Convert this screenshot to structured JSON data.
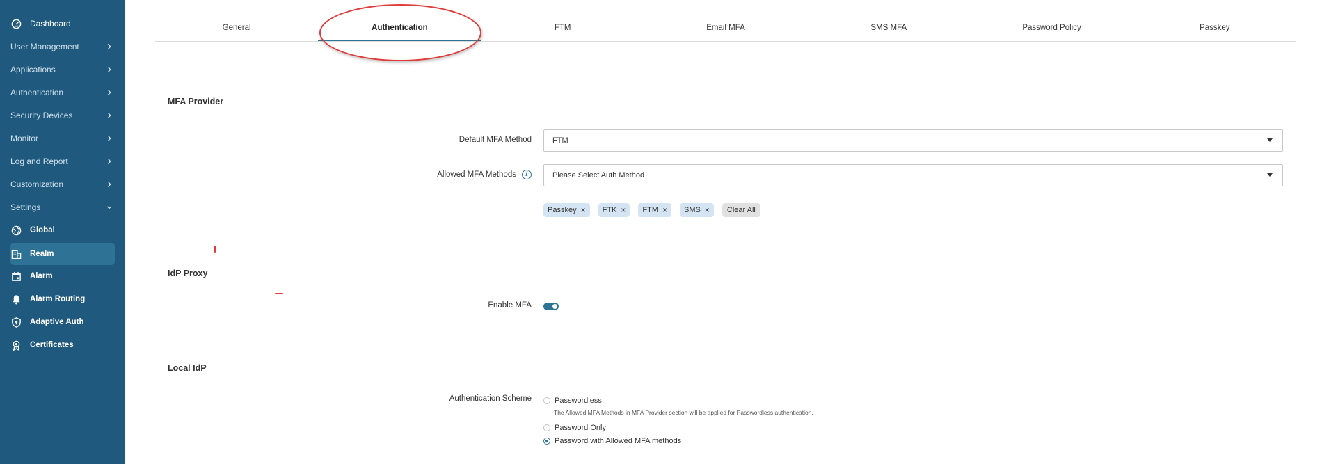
{
  "sidebar": {
    "items": [
      {
        "label": "Dashboard",
        "icon": "dashboard-icon"
      },
      {
        "label": "User Management",
        "chevron": "right"
      },
      {
        "label": "Applications",
        "chevron": "right"
      },
      {
        "label": "Authentication",
        "chevron": "right"
      },
      {
        "label": "Security Devices",
        "chevron": "right"
      },
      {
        "label": "Monitor",
        "chevron": "right"
      },
      {
        "label": "Log and Report",
        "chevron": "right"
      },
      {
        "label": "Customization",
        "chevron": "right"
      },
      {
        "label": "Settings",
        "chevron": "down"
      }
    ],
    "settings_children": [
      {
        "label": "Global",
        "icon": "globe-icon"
      },
      {
        "label": "Realm",
        "icon": "building-icon",
        "active": true
      },
      {
        "label": "Alarm",
        "icon": "calendar-icon"
      },
      {
        "label": "Alarm Routing",
        "icon": "bell-icon"
      },
      {
        "label": "Adaptive Auth",
        "icon": "shield-icon"
      },
      {
        "label": "Certificates",
        "icon": "certificate-icon"
      }
    ]
  },
  "tabs": [
    {
      "label": "General"
    },
    {
      "label": "Authentication",
      "active": true
    },
    {
      "label": "FTM"
    },
    {
      "label": "Email MFA"
    },
    {
      "label": "SMS MFA"
    },
    {
      "label": "Password Policy"
    },
    {
      "label": "Passkey"
    }
  ],
  "mfa_provider": {
    "title": "MFA Provider",
    "default_label": "Default MFA Method",
    "default_value": "FTM",
    "allowed_label": "Allowed MFA Methods",
    "allowed_placeholder": "Please Select Auth Method",
    "chips": [
      "Passkey",
      "FTK",
      "FTM",
      "SMS"
    ],
    "chip_remove": "×",
    "clear_all": "Clear All"
  },
  "idp_proxy": {
    "title": "IdP Proxy",
    "enable_label": "Enable MFA",
    "enable_value": true
  },
  "local_idp": {
    "title": "Local IdP",
    "scheme_label": "Authentication Scheme",
    "options": [
      {
        "label": "Passwordless",
        "checked": false
      },
      {
        "label": "Password Only",
        "checked": false
      },
      {
        "label": "Password with Allowed MFA methods",
        "checked": true
      }
    ],
    "passwordless_hint": "The Allowed MFA Methods in MFA Provider section will be applied for Passwordless authentication."
  },
  "colors": {
    "sidebar_bg": "#1f5a7e",
    "active_item": "#2e7396",
    "accent": "#2e7396",
    "chip_bg": "#d4e4f2",
    "annotation": "#e03c3c"
  }
}
